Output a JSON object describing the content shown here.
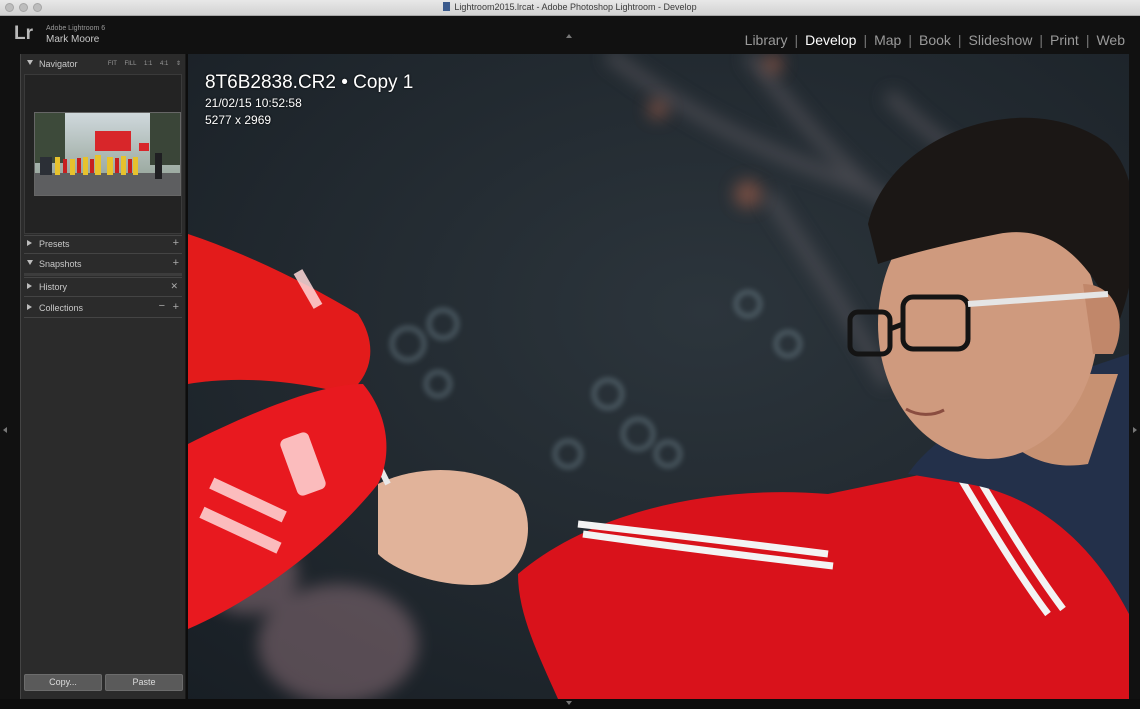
{
  "window": {
    "title": "Lightroom2015.lrcat - Adobe Photoshop Lightroom - Develop"
  },
  "app": {
    "logo": "Lr",
    "version": "Adobe Lightroom 6",
    "user": "Mark Moore"
  },
  "modules": [
    {
      "label": "Library",
      "active": false
    },
    {
      "label": "Develop",
      "active": true
    },
    {
      "label": "Map",
      "active": false
    },
    {
      "label": "Book",
      "active": false
    },
    {
      "label": "Slideshow",
      "active": false
    },
    {
      "label": "Print",
      "active": false
    },
    {
      "label": "Web",
      "active": false
    }
  ],
  "navigator": {
    "label": "Navigator",
    "options": [
      "FIT",
      "FILL",
      "1:1",
      "4:1"
    ]
  },
  "panels": {
    "presets": "Presets",
    "snapshots": "Snapshots",
    "history": "History",
    "collections": "Collections"
  },
  "buttons": {
    "copy": "Copy...",
    "paste": "Paste"
  },
  "photo": {
    "filename": "8T6B2838.CR2 • Copy 1",
    "date": "21/02/15 10:52:58",
    "dimensions": "5277 x 2969"
  },
  "colors": {
    "flag_red": "#e31b1b",
    "background": "#1b2229",
    "panel": "#2b2b2b",
    "active_module": "#ffffff"
  }
}
